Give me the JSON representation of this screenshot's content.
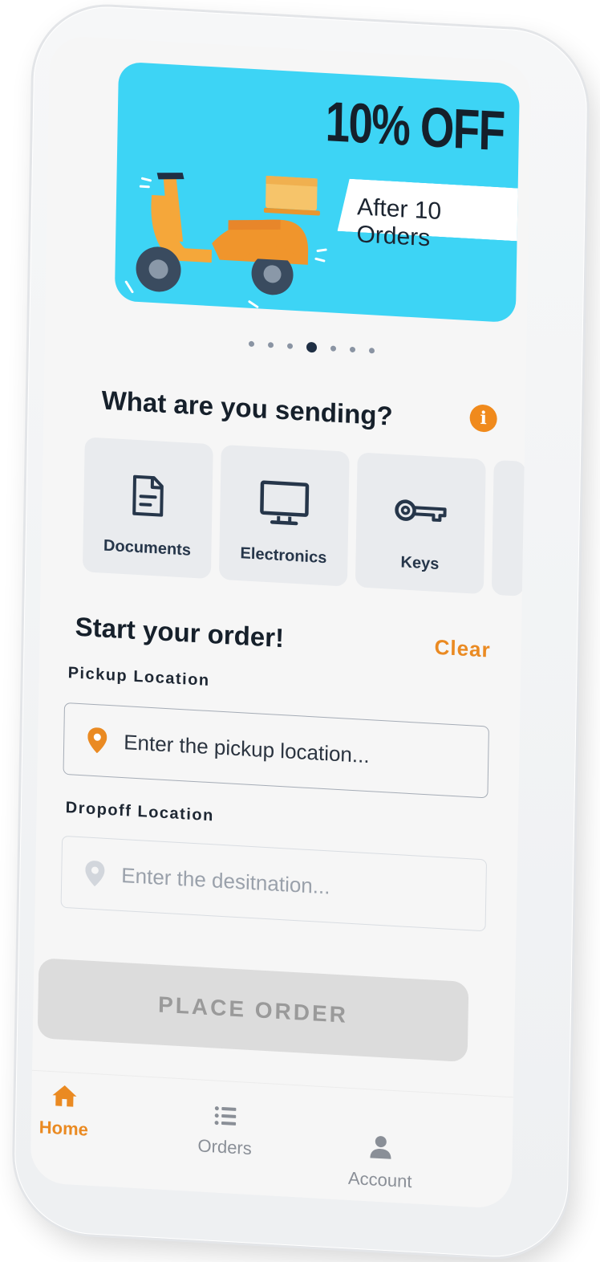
{
  "banner": {
    "headline": "10% OFF",
    "subline": "After 10 Orders",
    "slide_count": 7,
    "active_slide": 4
  },
  "sending": {
    "title": "What are you sending?",
    "info_icon": "info-icon",
    "categories": [
      {
        "label": "Documents",
        "icon": "document-icon"
      },
      {
        "label": "Electronics",
        "icon": "monitor-icon"
      },
      {
        "label": "Keys",
        "icon": "key-icon"
      }
    ]
  },
  "order": {
    "title": "Start your order!",
    "clear_label": "Clear",
    "pickup": {
      "label": "Pickup Location",
      "placeholder": "Enter the pickup location...",
      "value": ""
    },
    "dropoff": {
      "label": "Dropoff Location",
      "placeholder": "Enter the desitnation...",
      "value": ""
    },
    "submit_label": "PLACE ORDER"
  },
  "tabs": [
    {
      "label": "Home",
      "icon": "home-icon",
      "active": true
    },
    {
      "label": "Orders",
      "icon": "list-icon",
      "active": false
    },
    {
      "label": "Account",
      "icon": "person-icon",
      "active": false
    }
  ],
  "colors": {
    "accent": "#ea8a22",
    "banner_bg": "#3dd4f5",
    "dark_text": "#16202b",
    "icon_navy": "#26364a",
    "disabled_button": "#dcdcdc"
  }
}
